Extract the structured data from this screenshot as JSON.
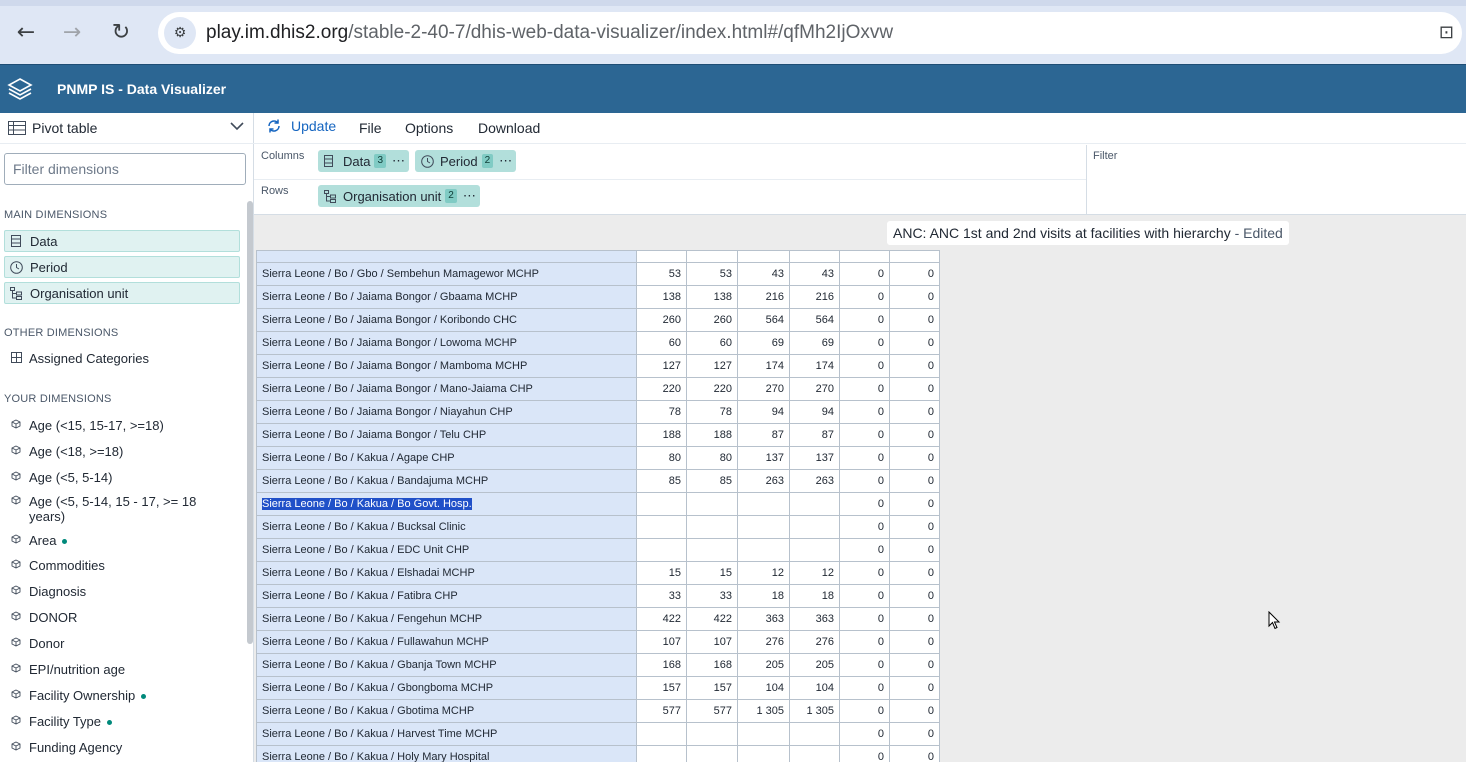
{
  "browser": {
    "url_host": "play.im.dhis2.org",
    "url_path": "/stable-2-40-7/dhis-web-data-visualizer/index.html#/qfMh2IjOxvw"
  },
  "header": {
    "title": "PNMP IS - Data Visualizer"
  },
  "left_panel": {
    "vis_type": "Pivot table",
    "filter_placeholder": "Filter dimensions",
    "main_label": "MAIN DIMENSIONS",
    "main_dims": [
      "Data",
      "Period",
      "Organisation unit"
    ],
    "other_label": "OTHER DIMENSIONS",
    "other_dims": [
      "Assigned Categories"
    ],
    "your_label": "YOUR DIMENSIONS",
    "your_dims": [
      {
        "label": "Age (<15, 15-17, >=18)",
        "dot": false
      },
      {
        "label": "Age (<18, >=18)",
        "dot": false
      },
      {
        "label": "Age (<5, 5-14)",
        "dot": false
      },
      {
        "label": "Age (<5, 5-14, 15 - 17, >= 18",
        "label2": "years)",
        "dot": false
      },
      {
        "label": "Area",
        "dot": true
      },
      {
        "label": "Commodities",
        "dot": false
      },
      {
        "label": "Diagnosis",
        "dot": false
      },
      {
        "label": "DONOR",
        "dot": false
      },
      {
        "label": "Donor",
        "dot": false
      },
      {
        "label": "EPI/nutrition age",
        "dot": false
      },
      {
        "label": "Facility Ownership",
        "dot": true
      },
      {
        "label": "Facility Type",
        "dot": true
      },
      {
        "label": "Funding Agency",
        "dot": false
      }
    ]
  },
  "menu": {
    "update": "Update",
    "file": "File",
    "options": "Options",
    "download": "Download"
  },
  "layout": {
    "columns_label": "Columns",
    "rows_label": "Rows",
    "filter_label": "Filter",
    "columns": [
      {
        "label": "Data",
        "count": "3"
      },
      {
        "label": "Period",
        "count": "2"
      }
    ],
    "rows": [
      {
        "label": "Organisation unit",
        "count": "2"
      }
    ]
  },
  "visualization": {
    "title": "ANC: ANC 1st and 2nd visits at facilities with hierarchy",
    "edited": " - Edited"
  },
  "table_rows": [
    {
      "ou": "Sierra Leone / Bo / Gbo / Sembehun Mamagewor MCHP",
      "v": [
        "53",
        "53",
        "43",
        "43",
        "0",
        "0"
      ]
    },
    {
      "ou": "Sierra Leone / Bo / Jaiama Bongor / Gbaama MCHP",
      "v": [
        "138",
        "138",
        "216",
        "216",
        "0",
        "0"
      ]
    },
    {
      "ou": "Sierra Leone / Bo / Jaiama Bongor / Koribondo CHC",
      "v": [
        "260",
        "260",
        "564",
        "564",
        "0",
        "0"
      ]
    },
    {
      "ou": "Sierra Leone / Bo / Jaiama Bongor / Lowoma MCHP",
      "v": [
        "60",
        "60",
        "69",
        "69",
        "0",
        "0"
      ]
    },
    {
      "ou": "Sierra Leone / Bo / Jaiama Bongor / Mamboma MCHP",
      "v": [
        "127",
        "127",
        "174",
        "174",
        "0",
        "0"
      ]
    },
    {
      "ou": "Sierra Leone / Bo / Jaiama Bongor / Mano-Jaiama CHP",
      "v": [
        "220",
        "220",
        "270",
        "270",
        "0",
        "0"
      ]
    },
    {
      "ou": "Sierra Leone / Bo / Jaiama Bongor / Niayahun CHP",
      "v": [
        "78",
        "78",
        "94",
        "94",
        "0",
        "0"
      ]
    },
    {
      "ou": "Sierra Leone / Bo / Jaiama Bongor / Telu CHP",
      "v": [
        "188",
        "188",
        "87",
        "87",
        "0",
        "0"
      ]
    },
    {
      "ou": "Sierra Leone / Bo / Kakua / Agape CHP",
      "v": [
        "80",
        "80",
        "137",
        "137",
        "0",
        "0"
      ]
    },
    {
      "ou": "Sierra Leone / Bo / Kakua / Bandajuma MCHP",
      "v": [
        "85",
        "85",
        "263",
        "263",
        "0",
        "0"
      ]
    },
    {
      "ou": "Sierra Leone / Bo / Kakua / Bo Govt. Hosp.",
      "v": [
        "",
        "",
        "",
        "",
        "0",
        "0"
      ],
      "selected": true
    },
    {
      "ou": "Sierra Leone / Bo / Kakua / Bucksal Clinic",
      "v": [
        "",
        "",
        "",
        "",
        "0",
        "0"
      ]
    },
    {
      "ou": "Sierra Leone / Bo / Kakua / EDC Unit CHP",
      "v": [
        "",
        "",
        "",
        "",
        "0",
        "0"
      ]
    },
    {
      "ou": "Sierra Leone / Bo / Kakua / Elshadai MCHP",
      "v": [
        "15",
        "15",
        "12",
        "12",
        "0",
        "0"
      ]
    },
    {
      "ou": "Sierra Leone / Bo / Kakua / Fatibra CHP",
      "v": [
        "33",
        "33",
        "18",
        "18",
        "0",
        "0"
      ]
    },
    {
      "ou": "Sierra Leone / Bo / Kakua / Fengehun MCHP",
      "v": [
        "422",
        "422",
        "363",
        "363",
        "0",
        "0"
      ]
    },
    {
      "ou": "Sierra Leone / Bo / Kakua / Fullawahun MCHP",
      "v": [
        "107",
        "107",
        "276",
        "276",
        "0",
        "0"
      ]
    },
    {
      "ou": "Sierra Leone / Bo / Kakua / Gbanja Town MCHP",
      "v": [
        "168",
        "168",
        "205",
        "205",
        "0",
        "0"
      ]
    },
    {
      "ou": "Sierra Leone / Bo / Kakua / Gbongboma MCHP",
      "v": [
        "157",
        "157",
        "104",
        "104",
        "0",
        "0"
      ]
    },
    {
      "ou": "Sierra Leone / Bo / Kakua / Gbotima MCHP",
      "v": [
        "577",
        "577",
        "1 305",
        "1 305",
        "0",
        "0"
      ]
    },
    {
      "ou": "Sierra Leone / Bo / Kakua / Harvest Time MCHP",
      "v": [
        "",
        "",
        "",
        "",
        "0",
        "0"
      ]
    },
    {
      "ou": "Sierra Leone / Bo / Kakua / Holy Mary Hospital",
      "v": [
        "",
        "",
        "",
        "",
        "0",
        "0"
      ]
    }
  ]
}
